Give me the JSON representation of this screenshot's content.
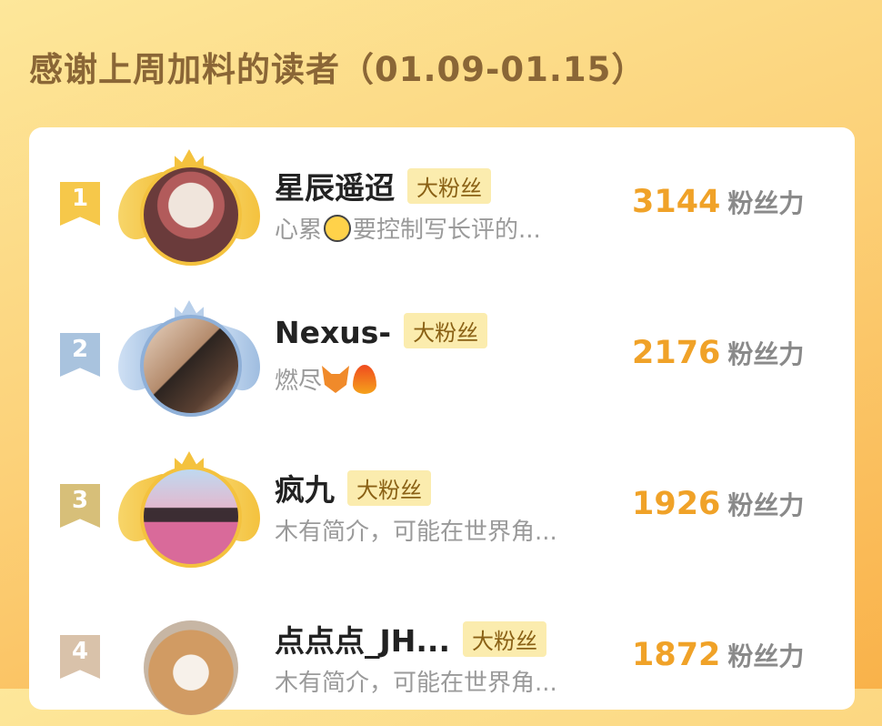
{
  "header": {
    "title": "感谢上周加料的读者（01.09-01.15）"
  },
  "colors": {
    "accent": "#f0a228",
    "tag_bg": "#fbecae",
    "tag_text": "#8a6115"
  },
  "readers": [
    {
      "rank": "1",
      "name": "星辰遥迢",
      "tag": "大粉丝",
      "bio_pre": "心累",
      "bio_icon": "grimacing-sweat-face-emoji",
      "bio_post": "要控制写长评的...",
      "score": "3144",
      "score_label": "粉丝力"
    },
    {
      "rank": "2",
      "name": "Nexus-",
      "tag": "大粉丝",
      "bio_pre": "燃尽",
      "bio_icons": [
        "fox-emoji",
        "fire-emoji"
      ],
      "score": "2176",
      "score_label": "粉丝力"
    },
    {
      "rank": "3",
      "name": "疯九",
      "tag": "大粉丝",
      "bio": "木有简介，可能在世界角...",
      "score": "1926",
      "score_label": "粉丝力"
    },
    {
      "rank": "4",
      "name": "点点点_JH...",
      "tag": "大粉丝",
      "bio": "木有简介，可能在世界角...",
      "score": "1872",
      "score_label": "粉丝力"
    }
  ]
}
